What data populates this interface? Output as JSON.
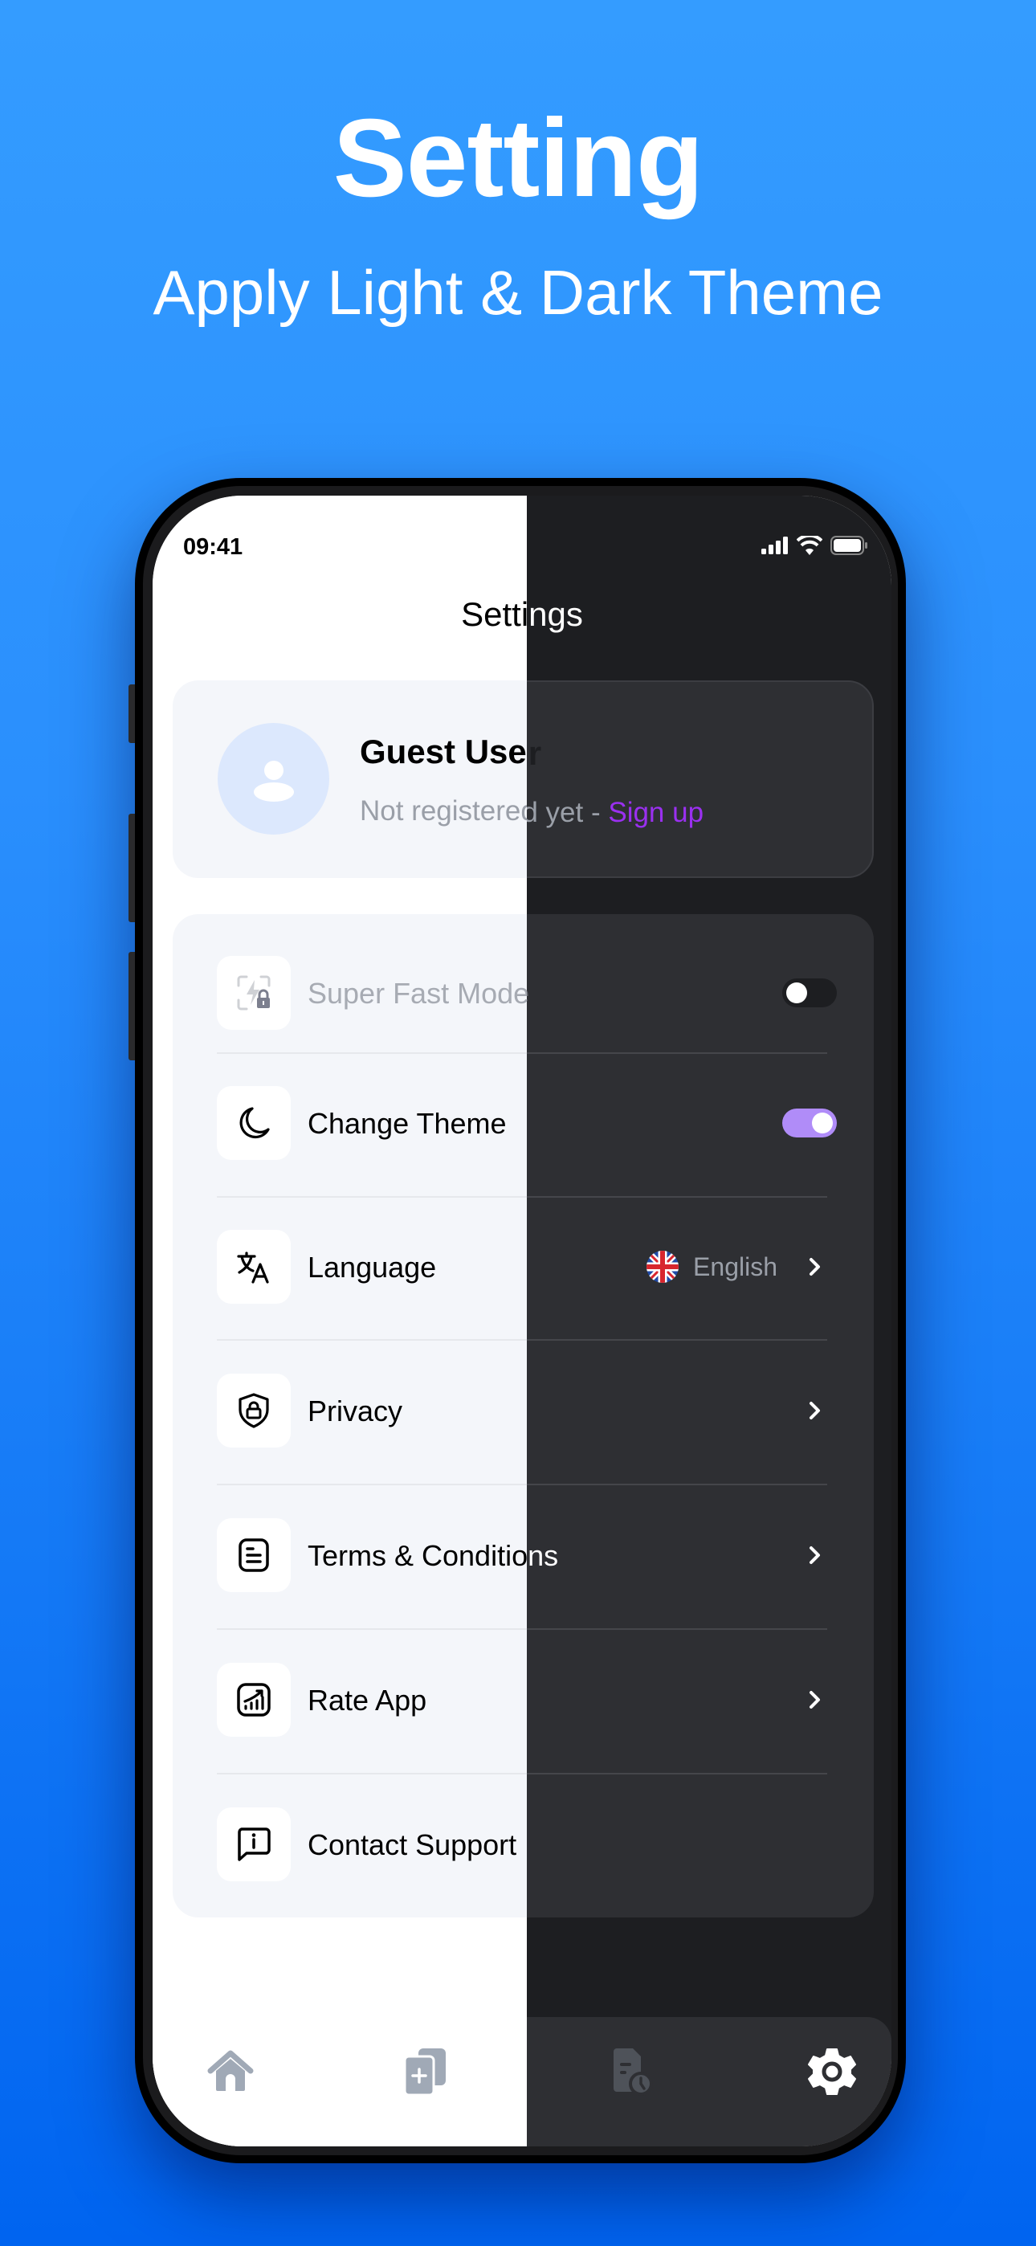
{
  "promo": {
    "title": "Setting",
    "subtitle": "Apply Light & Dark Theme"
  },
  "status_bar": {
    "time": "09:41",
    "icons": [
      "signal-icon",
      "wifi-icon",
      "battery-icon"
    ]
  },
  "header": {
    "title": "Settings"
  },
  "profile": {
    "name": "Guest User",
    "subtitle": "Not registered yet - ",
    "signup_label": "Sign up",
    "avatar_icon": "person-icon"
  },
  "menu": {
    "items": [
      {
        "label": "Super Fast Mode",
        "icon": "bolt-lock-icon",
        "control": "toggle",
        "on": false,
        "disabled": true
      },
      {
        "label": "Change Theme",
        "icon": "moon-icon",
        "control": "toggle",
        "on": true
      },
      {
        "label": "Language",
        "icon": "translate-icon",
        "control": "chevron",
        "value": "English",
        "value_icon": "uk-flag-icon"
      },
      {
        "label": "Privacy",
        "icon": "shield-lock-icon",
        "control": "chevron"
      },
      {
        "label": "Terms & Conditions",
        "icon": "document-icon",
        "control": "chevron"
      },
      {
        "label": "Rate App",
        "icon": "chart-up-icon",
        "control": "chevron"
      },
      {
        "label": "Contact Support",
        "icon": "info-message-icon",
        "control": "none"
      }
    ]
  },
  "bottom_nav": {
    "items": [
      {
        "name": "home",
        "icon": "home-icon",
        "active": false
      },
      {
        "name": "add-files",
        "icon": "add-files-icon",
        "active": false
      },
      {
        "name": "history",
        "icon": "file-clock-icon",
        "active": false
      },
      {
        "name": "settings",
        "icon": "gear-icon",
        "active": true
      }
    ]
  },
  "colors": {
    "background_top": "#349CFF",
    "background_bottom": "#0064F0",
    "accent_signup": "#9A30F0",
    "toggle_on": "#B08CF8",
    "light_card": "#F4F6FA",
    "dark_bg": "#1D1E21",
    "dark_card": "#2E2F33"
  }
}
